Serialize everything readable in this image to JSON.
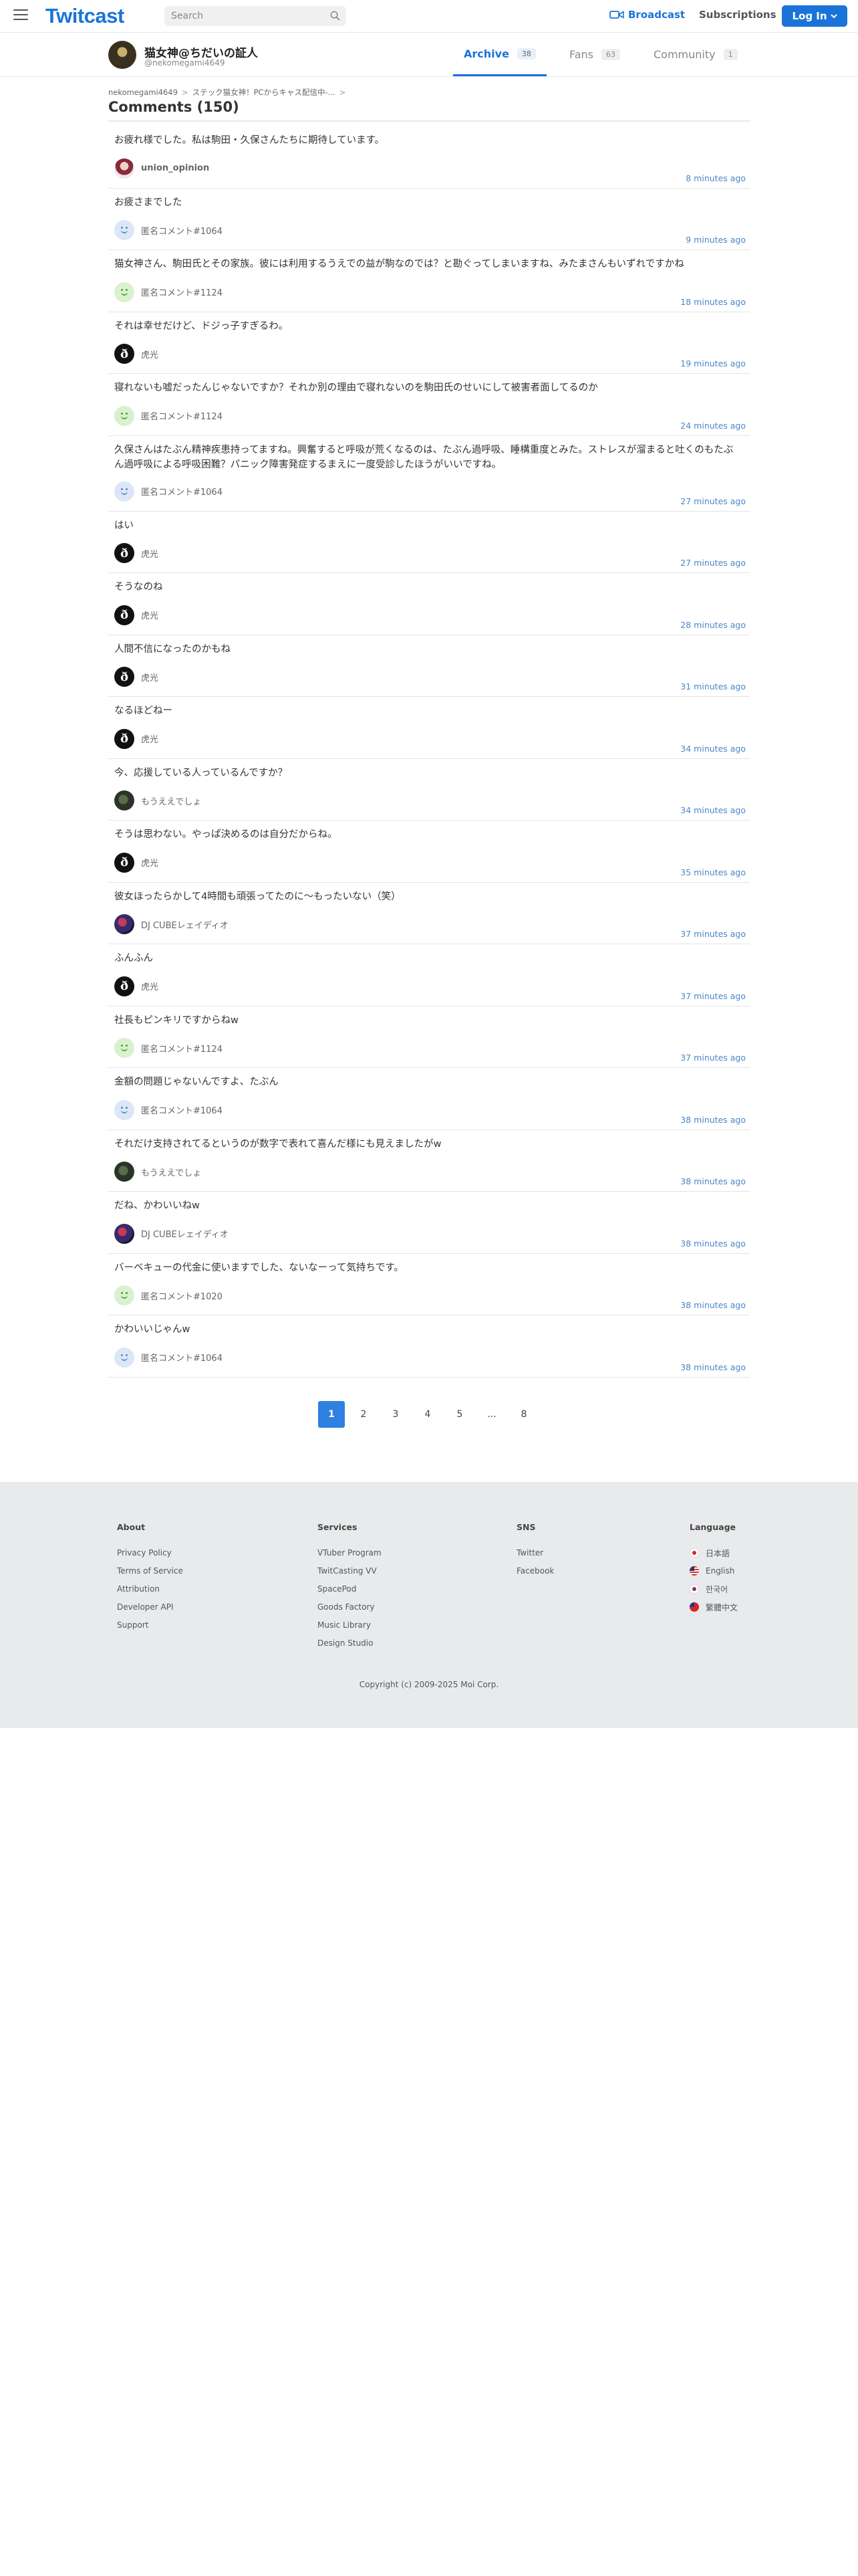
{
  "header": {
    "logo": "Twitcast",
    "search_placeholder": "Search",
    "broadcast_label": "Broadcast",
    "subscriptions_label": "Subscriptions",
    "login_label": "Log In",
    "accent_color": "#1a73d9"
  },
  "profile": {
    "name": "猫女神@ちだいの証人",
    "user_id": "@nekomegami4649",
    "tabs": [
      {
        "label": "Archive",
        "count": "38",
        "active": true
      },
      {
        "label": "Fans",
        "count": "63",
        "active": false
      },
      {
        "label": "Community",
        "count": "1",
        "active": false
      }
    ]
  },
  "breadcrumb": {
    "user": "nekomegami4649",
    "movie": "ステック猫女神！PCからキャス配信中-...",
    "sep": ">",
    "trail": "›"
  },
  "page_title": "Comments (150)",
  "comments": [
    {
      "text": "お疲れ様でした。私は駒田・久保さんたちに期待しています。",
      "user": "union_opinion",
      "avatar": "union",
      "time": "8 minutes ago",
      "bold": true
    },
    {
      "text": "お疲さまでした",
      "user": "匿名コメント#1064",
      "avatar": "anon",
      "time": "9 minutes ago"
    },
    {
      "text": "猫女神さん、駒田氏とその家族。彼には利用するうえでの益が駒なのでは？と勘ぐってしまいますね、みたまさんもいずれですかね",
      "user": "匿名コメント#1124",
      "avatar": "green",
      "time": "18 minutes ago"
    },
    {
      "text": "それは幸せだけど、ドジっ子すぎるわ。",
      "user": "虎光",
      "avatar": "tora",
      "time": "19 minutes ago"
    },
    {
      "text": "寝れないも嘘だったんじゃないですか？それか別の理由で寝れないのを駒田氏のせいにして被害者面してるのか",
      "user": "匿名コメント#1124",
      "avatar": "green",
      "time": "24 minutes ago"
    },
    {
      "text": "久保さんはたぶん精神疾患持ってますね。興奮すると呼吸が荒くなるのは、たぶん過呼吸、睡構重度とみた。ストレスが溜まると吐くのもたぶん過呼吸による呼吸困難？パニック障害発症するまえに一度受診したほうがいいですね。",
      "user": "匿名コメント#1064",
      "avatar": "anon",
      "time": "27 minutes ago"
    },
    {
      "text": "はい",
      "user": "虎光",
      "avatar": "tora",
      "time": "27 minutes ago"
    },
    {
      "text": "そうなのね",
      "user": "虎光",
      "avatar": "tora",
      "time": "28 minutes ago"
    },
    {
      "text": "人間不信になったのかもね",
      "user": "虎光",
      "avatar": "tora",
      "time": "31 minutes ago"
    },
    {
      "text": "なるほどねー",
      "user": "虎光",
      "avatar": "tora",
      "time": "34 minutes ago"
    },
    {
      "text": "今、応援している人っているんですか？",
      "user": "もうええでしょ",
      "avatar": "moe",
      "time": "34 minutes ago"
    },
    {
      "text": "そうは思わない。やっぱ決めるのは自分だからね。",
      "user": "虎光",
      "avatar": "tora",
      "time": "35 minutes ago"
    },
    {
      "text": "彼女ほったらかして4時間も頑張ってたのに〜もったいない（笑）",
      "user": "DJ CUBEレェイディオ",
      "avatar": "dj",
      "time": "37 minutes ago"
    },
    {
      "text": "ふんふん",
      "user": "虎光",
      "avatar": "tora",
      "time": "37 minutes ago"
    },
    {
      "text": "社長もピンキリですからねw",
      "user": "匿名コメント#1124",
      "avatar": "green",
      "time": "37 minutes ago"
    },
    {
      "text": "金額の問題じゃないんですよ、たぶん",
      "user": "匿名コメント#1064",
      "avatar": "anon",
      "time": "38 minutes ago"
    },
    {
      "text": "それだけ支持されてるというのが数字で表れて喜んだ様にも見えましたがw",
      "user": "もうええでしょ",
      "avatar": "moe",
      "time": "38 minutes ago"
    },
    {
      "text": "だね、かわいいねw",
      "user": "DJ CUBEレェイディオ",
      "avatar": "dj",
      "time": "38 minutes ago"
    },
    {
      "text": "バーベキューの代金に使いますでした、ないなーって気持ちです。",
      "user": "匿名コメント#1020",
      "avatar": "green",
      "time": "38 minutes ago"
    },
    {
      "text": "かわいいじゃんw",
      "user": "匿名コメント#1064",
      "avatar": "anon",
      "time": "38 minutes ago"
    }
  ],
  "pagination": {
    "pages": [
      "1",
      "2",
      "3",
      "4",
      "5",
      "...",
      "8"
    ],
    "current": "1"
  },
  "footer": {
    "about": {
      "heading": "About",
      "links": [
        "Privacy Policy",
        "Terms of Service",
        "Attribution",
        "Developer API",
        "Support"
      ]
    },
    "services": {
      "heading": "Services",
      "links": [
        "VTuber Program",
        "TwitCasting VV",
        "SpacePod",
        "Goods Factory",
        "Music Library",
        "Design Studio"
      ]
    },
    "sns": {
      "heading": "SNS",
      "links": [
        "Twitter",
        "Facebook"
      ]
    },
    "language": {
      "heading": "Language",
      "links": [
        {
          "label": "日本語",
          "flag": "jp"
        },
        {
          "label": "English",
          "flag": "us"
        },
        {
          "label": "한국어",
          "flag": "kr"
        },
        {
          "label": "繁體中文",
          "flag": "tw"
        }
      ]
    },
    "copyright": "Copyright (c) 2009-2025 Moi Corp."
  }
}
